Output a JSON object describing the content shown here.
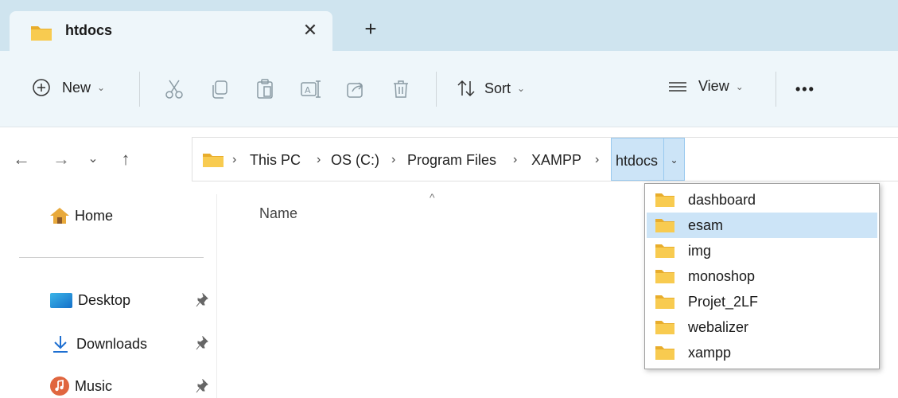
{
  "tab": {
    "title": "htdocs",
    "close_glyph": "✕",
    "new_tab_glyph": "+"
  },
  "toolbar": {
    "new_label": "New",
    "sort_label": "Sort",
    "view_label": "View",
    "more_glyph": "•••",
    "chevron": "⌄",
    "icons": [
      "cut-icon",
      "copy-icon",
      "paste-icon",
      "rename-icon",
      "share-icon",
      "delete-icon"
    ]
  },
  "nav": {
    "back": "←",
    "forward": "→",
    "recent": "⌄",
    "up": "↑"
  },
  "address": {
    "separator": "›",
    "crumbs": [
      "This PC",
      "OS (C:)",
      "Program Files",
      "XAMPP"
    ],
    "current": "htdocs",
    "dropdown_glyph": "⌄"
  },
  "sidebar": {
    "home": "Home",
    "items": [
      {
        "label": "Desktop",
        "pinned": true
      },
      {
        "label": "Downloads",
        "pinned": true
      },
      {
        "label": "Music",
        "pinned": true
      }
    ]
  },
  "content": {
    "column_name": "Name",
    "sort_caret": "^"
  },
  "dropdown": {
    "items": [
      "dashboard",
      "esam",
      "img",
      "monoshop",
      "Projet_2LF",
      "webalizer",
      "xampp"
    ],
    "selected_index": 1
  },
  "colors": {
    "folder": "#f4c542",
    "accent": "#cce4f7",
    "tabstrip": "#cfe4ef",
    "toolbar": "#eef6fa"
  }
}
